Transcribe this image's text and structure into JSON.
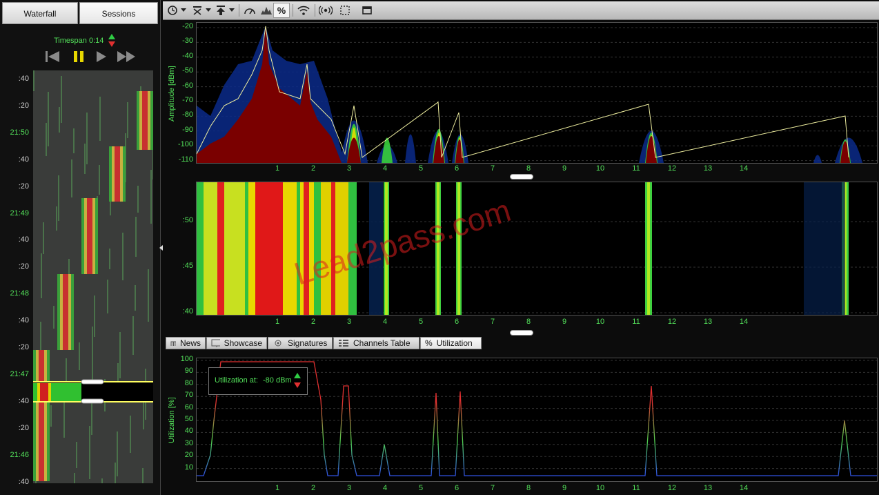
{
  "left_panel": {
    "tabs": [
      "Waterfall",
      "Sessions"
    ],
    "timespan": "Timespan 0:14",
    "time_labels": [
      {
        "text": ":40",
        "color": "#cfcfcf"
      },
      {
        "text": ":20",
        "color": "#cfcfcf"
      },
      {
        "text": "21:50",
        "color": "#53e15a"
      },
      {
        "text": ":40",
        "color": "#cfcfcf"
      },
      {
        "text": ":20",
        "color": "#cfcfcf"
      },
      {
        "text": "21:49",
        "color": "#53e15a"
      },
      {
        "text": ":40",
        "color": "#cfcfcf"
      },
      {
        "text": ":20",
        "color": "#cfcfcf"
      },
      {
        "text": "21:48",
        "color": "#53e15a"
      },
      {
        "text": ":40",
        "color": "#cfcfcf"
      },
      {
        "text": ":20",
        "color": "#cfcfcf"
      },
      {
        "text": "21:47",
        "color": "#53e15a"
      },
      {
        "text": ":40",
        "color": "#cfcfcf"
      },
      {
        "text": ":20",
        "color": "#cfcfcf"
      },
      {
        "text": "21:46",
        "color": "#53e15a"
      },
      {
        "text": ":40",
        "color": "#cfcfcf"
      }
    ]
  },
  "toolbar": {
    "icons": [
      "clock-icon",
      "filter-icon",
      "upload-icon",
      "gauge-icon",
      "spectrum-icon",
      "percent-icon",
      "wifi-icon",
      "broadcast-icon",
      "select-area-icon",
      "window-icon"
    ]
  },
  "spectrum": {
    "ylabel": "Amplitude [dBm]",
    "yticks": [
      "-20",
      "-30",
      "-40",
      "-50",
      "-60",
      "-70",
      "-80",
      "-90",
      "-100",
      "-110"
    ],
    "channels": [
      "1",
      "2",
      "3",
      "4",
      "5",
      "6",
      "7",
      "8",
      "9",
      "10",
      "11",
      "12",
      "13",
      "14"
    ]
  },
  "waterfall2": {
    "yticks": [
      ":50",
      ":45",
      ":40"
    ],
    "channels": [
      "1",
      "2",
      "3",
      "4",
      "5",
      "6",
      "7",
      "8",
      "9",
      "10",
      "11",
      "12",
      "13",
      "14"
    ]
  },
  "bottom_tabs": [
    "News",
    "Showcase",
    "Signatures",
    "Channels Table",
    "Utilization"
  ],
  "utilization": {
    "ylabel": "Utilization [%]",
    "yticks": [
      "100",
      "90",
      "80",
      "70",
      "60",
      "50",
      "40",
      "30",
      "20",
      "10"
    ],
    "channels": [
      "1",
      "2",
      "3",
      "4",
      "5",
      "6",
      "7",
      "8",
      "9",
      "10",
      "11",
      "12",
      "13",
      "14"
    ],
    "box_label": "Utilization at:",
    "box_value": "-80 dBm"
  },
  "watermark": "Lead2pass.com"
}
